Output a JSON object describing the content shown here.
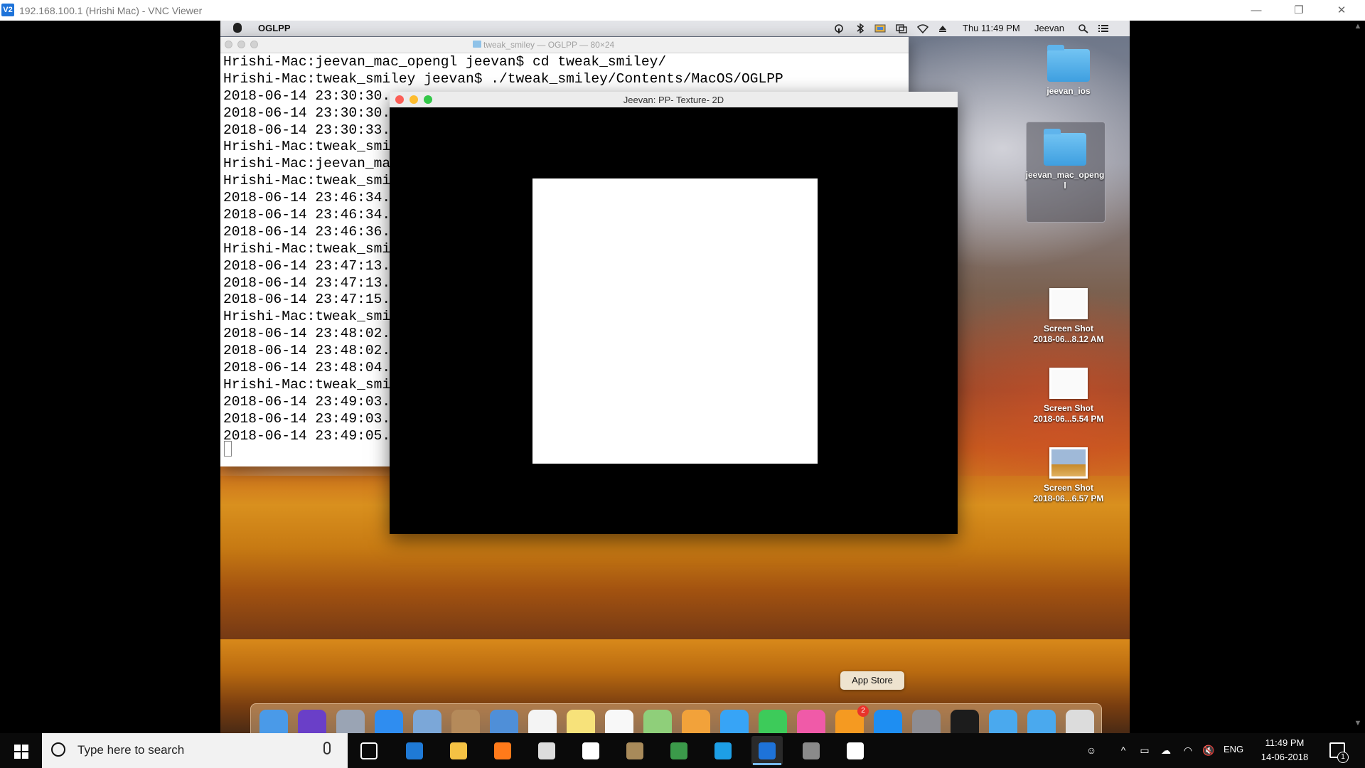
{
  "vnc": {
    "logo": "V2",
    "title": "192.168.100.1 (Hrishi Mac) - VNC Viewer",
    "controls": {
      "minimize": "—",
      "restore": "❐",
      "close": "✕"
    },
    "scroll_up": "▲",
    "scroll_down": "▼"
  },
  "menubar": {
    "app_name": "OGLPP",
    "clock": "Thu 11:49 PM",
    "user": "Jeevan",
    "status_icons": [
      "airdrop-icon",
      "bluetooth-icon",
      "keyboard-icon",
      "display-icon",
      "wifi-icon",
      "eject-icon",
      "spotlight-icon",
      "notification-center-icon"
    ]
  },
  "terminal": {
    "title": "tweak_smiley — OGLPP — 80×24",
    "lines": [
      "Hrishi-Mac:jeevan_mac_opengl jeevan$ cd tweak_smiley/",
      "Hrishi-Mac:tweak_smiley jeevan$ ./tweak_smiley/Contents/MacOS/OGLPP",
      "2018-06-14 23:30:30.",
      "2018-06-14 23:30:30.",
      "2018-06-14 23:30:33.",
      "Hrishi-Mac:tweak_smi",
      "Hrishi-Mac:jeevan_ma",
      "Hrishi-Mac:tweak_smi",
      "2018-06-14 23:46:34.",
      "2018-06-14 23:46:34.",
      "2018-06-14 23:46:36.",
      "Hrishi-Mac:tweak_smi",
      "2018-06-14 23:47:13.",
      "2018-06-14 23:47:13.",
      "2018-06-14 23:47:15.",
      "Hrishi-Mac:tweak_smi",
      "2018-06-14 23:48:02.",
      "2018-06-14 23:48:02.",
      "2018-06-14 23:48:04.",
      "Hrishi-Mac:tweak_smi",
      "2018-06-14 23:49:03.",
      "2018-06-14 23:49:03.",
      "2018-06-14 23:49:05."
    ]
  },
  "gl_window": {
    "title": "Jeevan: PP- Texture- 2D",
    "colors": {
      "close": "#fc5f57",
      "minimize": "#fdbc2e",
      "zoom": "#33c748"
    }
  },
  "desktop": {
    "icons": [
      {
        "label": "jeevan_ios",
        "kind": "folder"
      },
      {
        "label": "jeevan_mac_openg\nl",
        "kind": "folder"
      },
      {
        "label": "Screen Shot\n2018-06...8.12 AM",
        "kind": "screenshot"
      },
      {
        "label": "Screen Shot\n2018-06...5.54 PM",
        "kind": "screenshot"
      },
      {
        "label": "Screen Shot\n2018-06...6.57 PM",
        "kind": "screenshot"
      }
    ]
  },
  "dock": {
    "tooltip": "App Store",
    "app_store_badge": "2",
    "items": [
      {
        "name": "finder-icon",
        "color": "#4a9ae8"
      },
      {
        "name": "siri-icon",
        "color": "#6a3fc8"
      },
      {
        "name": "launchpad-icon",
        "color": "#9aa4b4"
      },
      {
        "name": "safari-icon",
        "color": "#2f8df0"
      },
      {
        "name": "preview-icon",
        "color": "#7ba7d8"
      },
      {
        "name": "contacts-icon",
        "color": "#b58a5a"
      },
      {
        "name": "xcode-icon",
        "color": "#4f8fd8"
      },
      {
        "name": "calendar-icon",
        "color": "#f4f4f4"
      },
      {
        "name": "notes-icon",
        "color": "#f7e27a"
      },
      {
        "name": "reminders-icon",
        "color": "#f8f8f8"
      },
      {
        "name": "maps-icon",
        "color": "#8fcf7a"
      },
      {
        "name": "photos-icon",
        "color": "#f2a23a"
      },
      {
        "name": "messages-icon",
        "color": "#37a4f6"
      },
      {
        "name": "facetime-icon",
        "color": "#3dcb5a"
      },
      {
        "name": "itunes-icon",
        "color": "#f05aa8"
      },
      {
        "name": "ibooks-icon",
        "color": "#f59a21"
      },
      {
        "name": "app-store-icon",
        "color": "#1e8ef2"
      },
      {
        "name": "system-preferences-icon",
        "color": "#8d8d93"
      },
      {
        "name": "terminal-icon",
        "color": "#1c1c1c"
      },
      {
        "name": "folder-icon",
        "color": "#4aa9ee"
      },
      {
        "name": "downloads-folder-icon",
        "color": "#4aa9ee"
      },
      {
        "name": "trash-icon",
        "color": "#dcdcdc"
      }
    ]
  },
  "taskbar": {
    "search_placeholder": "Type here to search",
    "apps": [
      {
        "name": "task-view-icon",
        "color": "#ffffff"
      },
      {
        "name": "edge-icon",
        "color": "#1f7ad6"
      },
      {
        "name": "file-explorer-icon",
        "color": "#f5c244"
      },
      {
        "name": "firefox-icon",
        "color": "#ff7a1a"
      },
      {
        "name": "media-app-icon",
        "color": "#dddddd"
      },
      {
        "name": "slack-icon",
        "color": "#ffffff"
      },
      {
        "name": "settings-app-icon",
        "color": "#a88a5a"
      },
      {
        "name": "spreadsheet-icon",
        "color": "#3b9a4a"
      },
      {
        "name": "skype-icon",
        "color": "#1d9fe6"
      },
      {
        "name": "vnc-viewer-icon",
        "color": "#1e73d9"
      },
      {
        "name": "snipping-tool-icon",
        "color": "#8a8a8a"
      },
      {
        "name": "photos-app-icon",
        "color": "#ffffff"
      }
    ],
    "tray": {
      "people": "☺",
      "chevron": "^",
      "battery": "▭",
      "cloud": "☁",
      "wifi": "◠",
      "volume": "🔇",
      "language": "ENG",
      "time": "11:49 PM",
      "date": "14-06-2018",
      "notifications": "1"
    }
  }
}
